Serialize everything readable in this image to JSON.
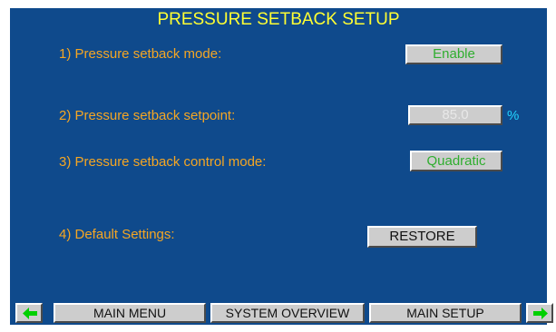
{
  "title": "PRESSURE SETBACK SETUP",
  "rows": [
    {
      "label": "1) Pressure setback mode:",
      "value": "Enable"
    },
    {
      "label": "2) Pressure setback setpoint:",
      "value": "85.0",
      "unit": "%"
    },
    {
      "label": "3) Pressure setback control mode:",
      "value": "Quadratic"
    },
    {
      "label": "4) Default Settings:",
      "value": "RESTORE"
    }
  ],
  "footer": {
    "left_arrow_icon": "left-arrow-icon",
    "main_menu": "MAIN MENU",
    "system_overview": "SYSTEM OVERVIEW",
    "main_setup": "MAIN SETUP",
    "right_arrow_icon": "right-arrow-icon"
  },
  "colors": {
    "background": "#0f4a8c",
    "title": "#ffff33",
    "label": "#f5a623",
    "value_green": "#2fae2f",
    "unit": "#22d3ff",
    "button": "#cdcdcd"
  }
}
